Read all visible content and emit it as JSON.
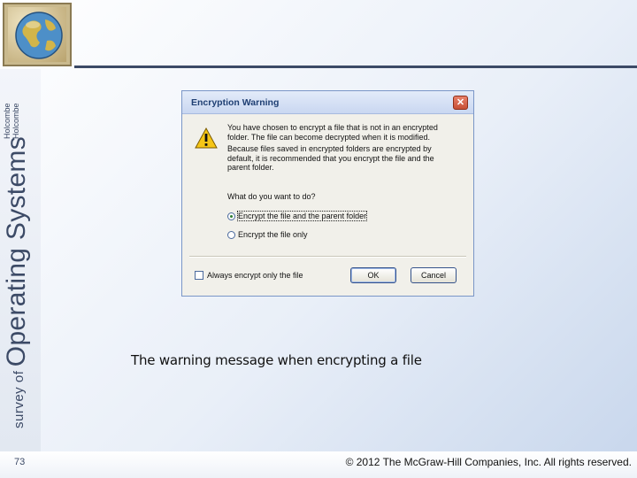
{
  "side": {
    "author_1": "Holcombe",
    "author_2": "Holcombe",
    "title_small": "survey of",
    "title_big": "Operating Systems"
  },
  "dialog": {
    "title": "Encryption Warning",
    "close_icon": "close-icon",
    "warning_icon": "warning-icon",
    "message": "You have chosen to encrypt a file that is not in an encrypted folder. The file can become decrypted when it is modified.",
    "explanation": "Because files saved in encrypted folders are encrypted by default, it is recommended that you encrypt the file and the parent folder.",
    "question": "What do you want to do?",
    "option_1": "Encrypt the file and the parent folder",
    "option_2": "Encrypt the file only",
    "checkbox_label": "Always encrypt only the file",
    "ok_label": "OK",
    "cancel_label": "Cancel"
  },
  "caption": "The warning message when encrypting a file",
  "footer": {
    "page_number": "73",
    "copyright": "© 2012 The McGraw-Hill Companies, Inc. All rights reserved."
  },
  "colors": {
    "accent": "#3c4a66",
    "title_bar": "#c9d7f1",
    "close_button": "#c74f35"
  }
}
